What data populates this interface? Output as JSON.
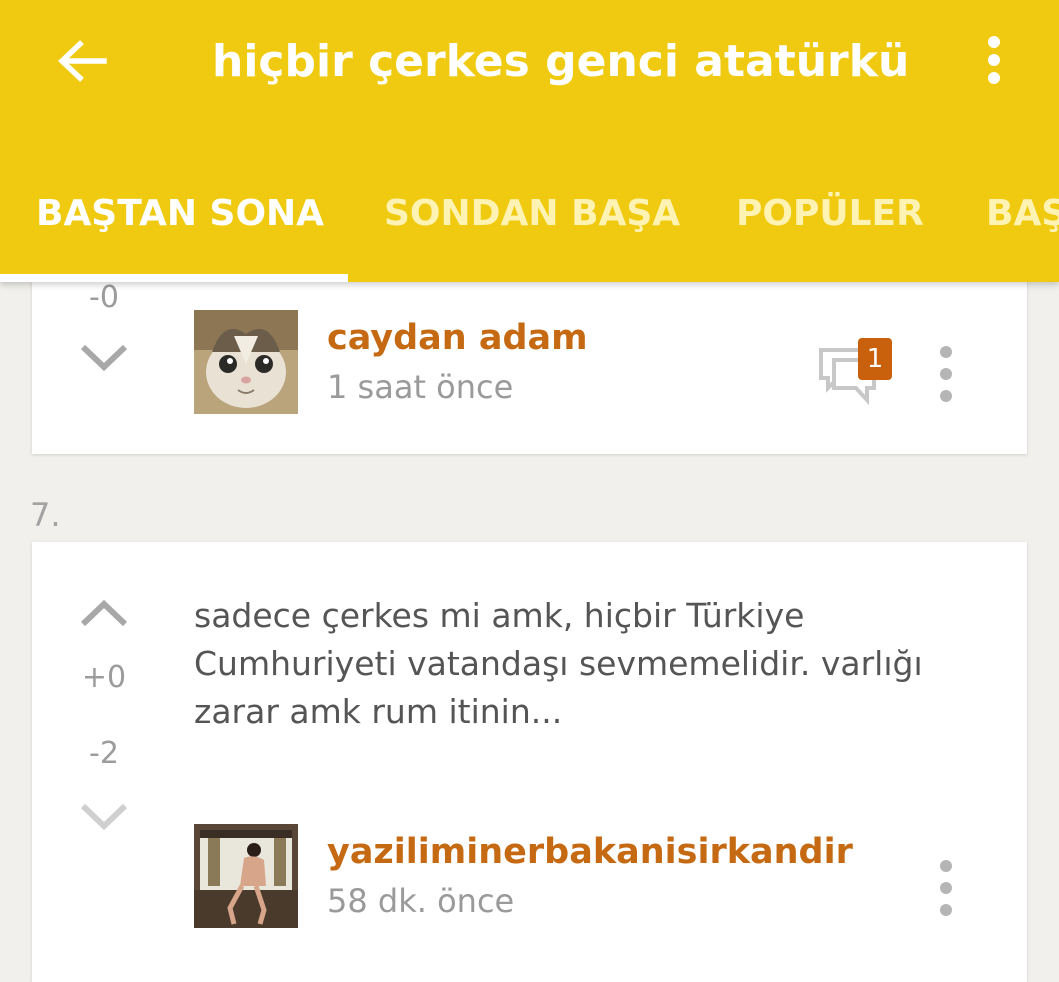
{
  "header": {
    "title": "hiçbir çerkes genci atatürkü..."
  },
  "tabs": [
    {
      "label": "BAŞTAN SONA",
      "active": true
    },
    {
      "label": "SONDAN BAŞA",
      "active": false
    },
    {
      "label": "POPÜLER",
      "active": false
    },
    {
      "label": "BAŞ",
      "active": false
    }
  ],
  "entries": [
    {
      "down_votes": "-0",
      "username": "caydan adam",
      "time": "1 saat  önce",
      "comment_count": "1"
    },
    {
      "number": "7.",
      "up_votes": "+0",
      "down_votes": "-2",
      "text": "sadece çerkes mi amk, hiçbir Türkiye Cumhuriyeti vatandaşı sevmemelidir. varlığı zarar amk rum itinin...",
      "username": "yaziliminerbakanisirkandir",
      "time": "58 dk. önce"
    }
  ],
  "colors": {
    "appbar": "#f0ca10",
    "username": "#c56a12",
    "badge": "#c8600c",
    "background": "#f1f0ec"
  },
  "icons": {
    "back": "arrow-back-icon",
    "menu": "more-vert-icon",
    "upvote": "chevron-up-icon",
    "downvote": "chevron-down-icon",
    "comments": "comments-icon"
  }
}
